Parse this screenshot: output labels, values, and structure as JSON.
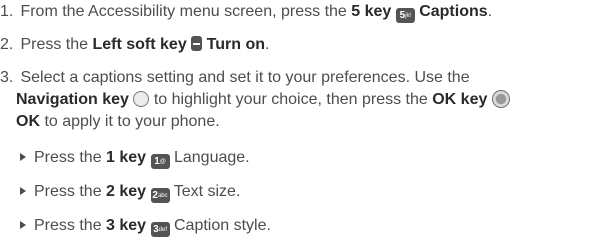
{
  "steps": [
    {
      "number": "1.",
      "text_before": "From the Accessibility menu screen, press the ",
      "key_label": "5 key",
      "icon": {
        "name": "key-5-icon",
        "main": "5",
        "sub": "jkl"
      },
      "action": "Captions",
      "text_after": "."
    },
    {
      "number": "2.",
      "text_before": "Press the ",
      "key_label": "Left soft key",
      "icon": {
        "name": "left-soft-key-icon"
      },
      "action": "Turn on",
      "text_after": "."
    },
    {
      "number": "3.",
      "line1": "Select a captions setting and set it to your preferences. Use the",
      "nav_label": "Navigation key",
      "nav_icon": "navigation-key-icon",
      "line2_mid": " to highlight your choice, then press the ",
      "ok_label": "OK key",
      "ok_icon": "ok-key-icon",
      "line3_action": "OK",
      "line3_after": " to apply it to your phone."
    }
  ],
  "substeps": [
    {
      "text_before": "Press the ",
      "key_label": "1 key",
      "icon": {
        "name": "key-1-icon",
        "main": "1",
        "sub": "@"
      },
      "action": "Language",
      "text_after": "."
    },
    {
      "text_before": "Press the ",
      "key_label": "2 key",
      "icon": {
        "name": "key-2-icon",
        "main": "2",
        "sub": "abc"
      },
      "action": "Text size",
      "text_after": "."
    },
    {
      "text_before": "Press the ",
      "key_label": "3 key",
      "icon": {
        "name": "key-3-icon",
        "main": "3",
        "sub": "def"
      },
      "action": "Caption style",
      "text_after": "."
    }
  ]
}
